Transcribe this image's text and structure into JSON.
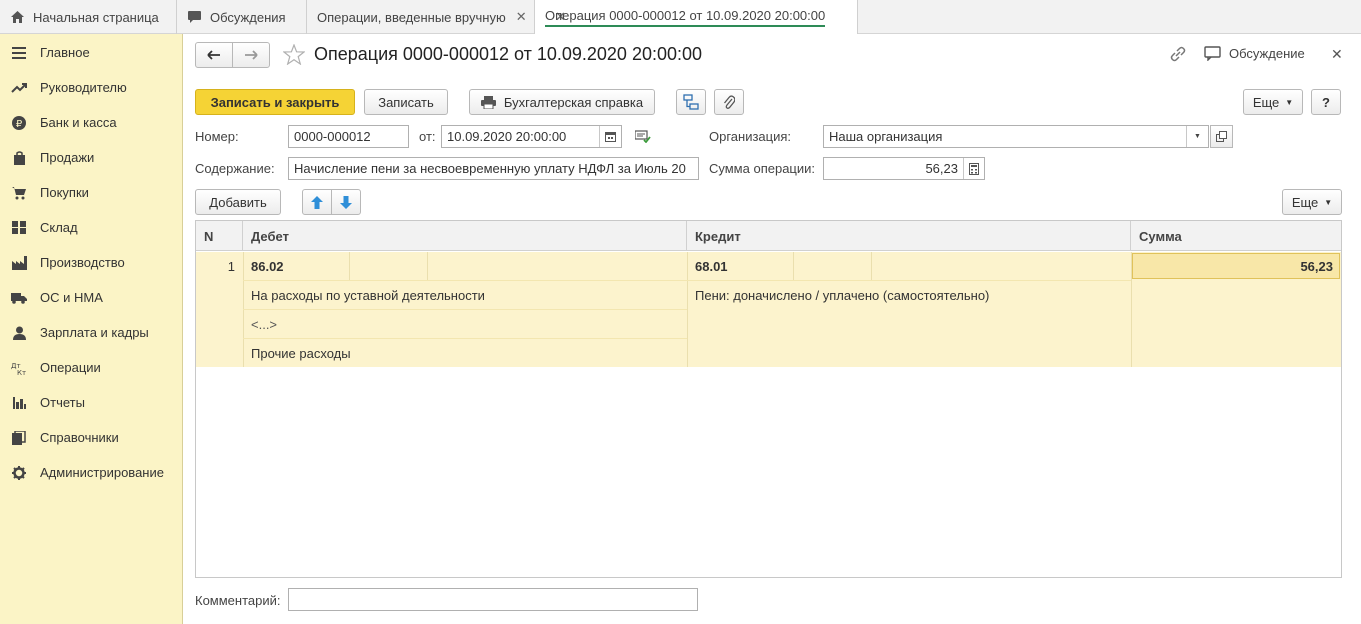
{
  "tabs": [
    {
      "label": "Начальная страница",
      "icon": "home-icon",
      "closable": false
    },
    {
      "label": "Обсуждения",
      "icon": "chat-icon",
      "closable": false
    },
    {
      "label": "Операции, введенные вручную",
      "icon": "",
      "closable": true
    },
    {
      "label": "Операция 0000-000012 от 10.09.2020 20:00:00",
      "icon": "",
      "closable": true,
      "active": true
    }
  ],
  "sidebar": {
    "items": [
      {
        "label": "Главное",
        "icon": "menu-icon"
      },
      {
        "label": "Руководителю",
        "icon": "trend-icon"
      },
      {
        "label": "Банк и касса",
        "icon": "ruble-icon"
      },
      {
        "label": "Продажи",
        "icon": "bag-icon"
      },
      {
        "label": "Покупки",
        "icon": "cart-icon"
      },
      {
        "label": "Склад",
        "icon": "warehouse-icon"
      },
      {
        "label": "Производство",
        "icon": "factory-icon"
      },
      {
        "label": "ОС и НМА",
        "icon": "truck-icon"
      },
      {
        "label": "Зарплата и кадры",
        "icon": "person-icon"
      },
      {
        "label": "Операции",
        "icon": "dt-kt-icon"
      },
      {
        "label": "Отчеты",
        "icon": "bar-chart-icon"
      },
      {
        "label": "Справочники",
        "icon": "books-icon"
      },
      {
        "label": "Администрирование",
        "icon": "gear-icon"
      }
    ]
  },
  "header": {
    "title": "Операция 0000-000012 от 10.09.2020 20:00:00",
    "discussion_label": "Обсуждение"
  },
  "toolbar": {
    "save_close": "Записать и закрыть",
    "save": "Записать",
    "print": "Бухгалтерская справка",
    "more": "Еще",
    "help": "?"
  },
  "form": {
    "number_label": "Номер:",
    "number_value": "0000-000012",
    "date_label": "от:",
    "date_value": "10.09.2020 20:00:00",
    "org_label": "Организация:",
    "org_value": "Наша организация",
    "content_label": "Содержание:",
    "content_value": "Начисление пени за несвоевременную уплату НДФЛ за Июль 20",
    "sum_label": "Сумма операции:",
    "sum_value": "56,23",
    "comment_label": "Комментарий:",
    "comment_value": ""
  },
  "table_toolbar": {
    "add": "Добавить",
    "more": "Еще"
  },
  "table": {
    "columns": [
      "N",
      "Дебет",
      "Кредит",
      "Сумма"
    ],
    "rows": [
      {
        "n": "1",
        "debit_account": "86.02",
        "debit_sub1": "На расходы по уставной деятельности",
        "debit_sub2": "<...>",
        "debit_sub3": "Прочие расходы",
        "credit_account": "68.01",
        "credit_sub1": "Пени: доначислено / уплачено (самостоятельно)",
        "sum": "56,23"
      }
    ]
  },
  "colors": {
    "sidebar_bg": "#fbf4c6",
    "primary_button": "#f5d335",
    "selected_row": "#fcf3cd",
    "active_tab_underline": "#2e8b57",
    "nav_arrow_blue": "#2f8fd8"
  }
}
